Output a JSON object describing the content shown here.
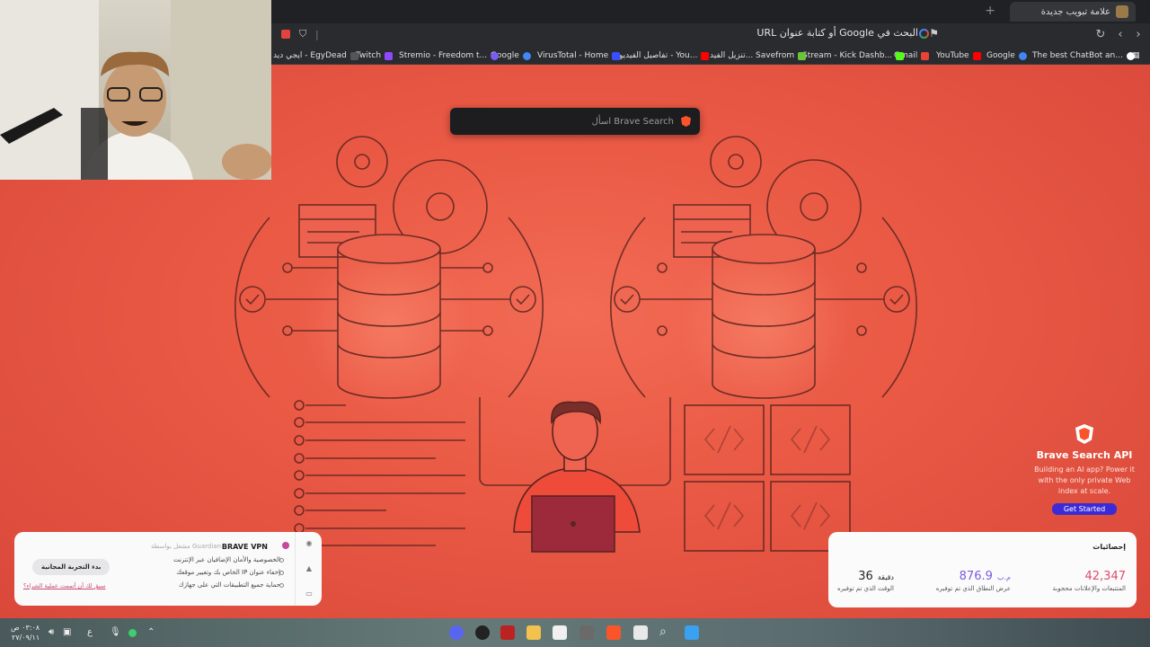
{
  "browser": {
    "tab_title": "علامة تبويب جديدة",
    "url_placeholder": "البحث في Google أو كتابة عنوان URL",
    "bookmarks": [
      {
        "label": "The best ChatBot an...",
        "color": "#ffffff"
      },
      {
        "label": "Google",
        "color": "#4285f4"
      },
      {
        "label": "YouTube",
        "color": "#ff0000"
      },
      {
        "label": "Gmail",
        "color": "#ea4335"
      },
      {
        "label": "Stream - Kick Dashb...",
        "color": "#53fc18"
      },
      {
        "label": "تنزيل الفيد... Savefrom",
        "color": "#6bc33b"
      },
      {
        "label": "تفاصيل الفيديو - You...",
        "color": "#ff0000"
      },
      {
        "label": "VirusTotal - Home",
        "color": "#394eff"
      },
      {
        "label": "Google",
        "color": "#4285f4"
      },
      {
        "label": "Stremio - Freedom t...",
        "color": "#7b5bf5"
      },
      {
        "label": "Twitch",
        "color": "#9146ff"
      },
      {
        "label": "ايجي ديد - EgyDead",
        "color": "#555555"
      }
    ]
  },
  "search": {
    "placeholder": "اسأل Brave Search"
  },
  "api": {
    "title": "Brave Search API",
    "description": "Building an AI app? Power it with the only private Web index at scale.",
    "button": "Get Started"
  },
  "vpn": {
    "title": "BRAVE VPN",
    "guardian": "مشغل بواسطة Guardian",
    "features": [
      "الخصوصية والأمان الإضافيان عبر الإنترنت",
      "إخفاء عنوان IP الخاص بك وتغيير موقعك",
      "حماية جميع التطبيقات التي على جهازك"
    ],
    "button": "بدء التجربة المجانية",
    "link": "سبق لك أن أتممت عملية الشراء؟"
  },
  "stats": {
    "title": "إحصائيات",
    "items": [
      {
        "value": "42,347",
        "unit": "",
        "label": "المتتبعات والإعلانات محجوبة",
        "color": "#e24a6a"
      },
      {
        "value": "876.9",
        "unit": "م.ب",
        "label": "عرض النطاق الذي تم توفيره",
        "color": "#7a5ae0"
      },
      {
        "value": "36",
        "unit": "دقيقة",
        "label": "الوقت الذي تم توفيره",
        "color": "#222222"
      }
    ]
  },
  "taskbar": {
    "time": "٠٣:٠٨ ص",
    "date": "٢٧/٠٩/١١",
    "lang": "ع"
  }
}
